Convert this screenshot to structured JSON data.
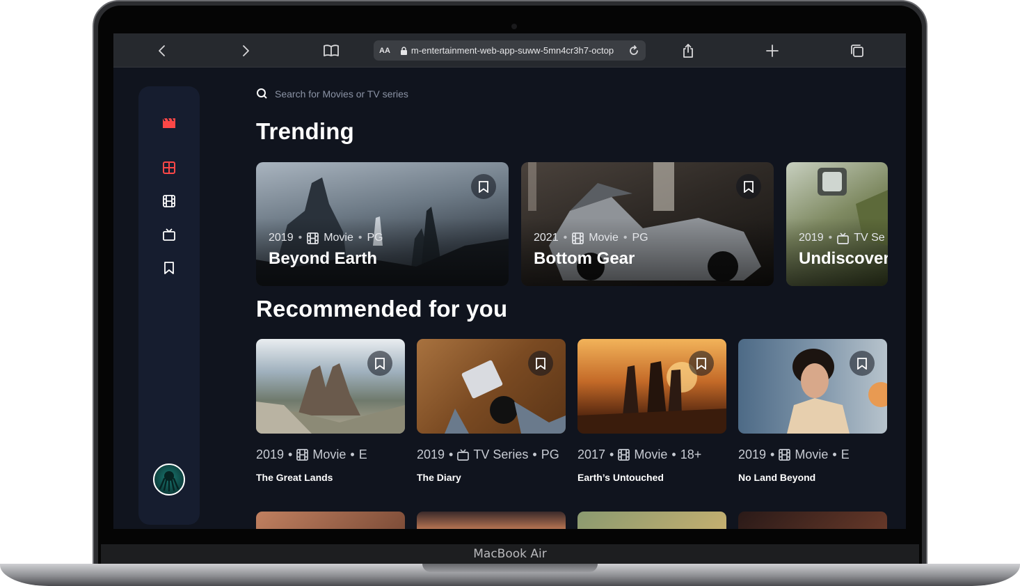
{
  "device": {
    "label": "MacBook Air"
  },
  "browser": {
    "url_aa": "AA",
    "url": "m-entertainment-web-app-suww-5mn4cr3h7-octop",
    "icons": [
      "back-icon",
      "forward-icon",
      "reader-icon",
      "lock-icon",
      "reload-icon",
      "share-icon",
      "new-tab-icon",
      "tabs-icon"
    ]
  },
  "search": {
    "placeholder": "Search for Movies or TV series"
  },
  "sections": {
    "trending": "Trending",
    "recommended": "Recommended for you"
  },
  "colors": {
    "accent": "#fc4747",
    "background": "#10141e",
    "sidebar": "#161d2f",
    "muted": "#5a698f"
  },
  "nav": {
    "items": [
      {
        "name": "home",
        "icon": "grid-icon",
        "active": true
      },
      {
        "name": "movies",
        "icon": "film-icon"
      },
      {
        "name": "tv-series",
        "icon": "tv-icon"
      },
      {
        "name": "bookmarks",
        "icon": "bookmark-icon"
      }
    ]
  },
  "trending": [
    {
      "year": "2019",
      "sep1": "•",
      "category": "Movie",
      "sep2": "•",
      "rating": "PG",
      "title": "Beyond Earth",
      "icon": "film-icon"
    },
    {
      "year": "2021",
      "sep1": "•",
      "category": "Movie",
      "sep2": "•",
      "rating": "PG",
      "title": "Bottom Gear",
      "icon": "film-icon"
    },
    {
      "year": "2019",
      "sep1": "•",
      "category": "TV Se",
      "title": "Undiscover",
      "icon": "tv-icon"
    }
  ],
  "recommended": [
    {
      "year": "2019",
      "sep1": "•",
      "category": "Movie",
      "sep2": "•",
      "rating": "E",
      "title": "The Great Lands",
      "icon": "film-icon"
    },
    {
      "year": "2019",
      "sep1": "•",
      "category": "TV Series",
      "sep2": "•",
      "rating": "PG",
      "title": "The Diary",
      "icon": "tv-icon"
    },
    {
      "year": "2017",
      "sep1": "•",
      "category": "Movie",
      "sep2": "•",
      "rating": "18+",
      "title": "Earth’s Untouched",
      "icon": "film-icon"
    },
    {
      "year": "2019",
      "sep1": "•",
      "category": "Movie",
      "sep2": "•",
      "rating": "E",
      "title": "No Land Beyond",
      "icon": "film-icon"
    }
  ]
}
